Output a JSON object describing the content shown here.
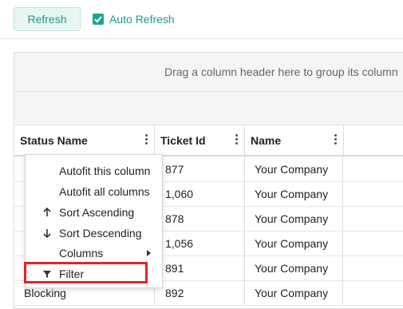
{
  "toolbar": {
    "refresh_label": "Refresh",
    "auto_refresh_label": "Auto Refresh",
    "auto_refresh_checked": true
  },
  "grid": {
    "group_panel_text": "Drag a column header here to group its column",
    "columns": [
      {
        "label": "Status Name"
      },
      {
        "label": "Ticket Id"
      },
      {
        "label": "Name"
      }
    ],
    "rows": [
      {
        "status": "",
        "ticket": "877",
        "name": "Your Company"
      },
      {
        "status": "",
        "ticket": "1,060",
        "name": "Your Company"
      },
      {
        "status": "",
        "ticket": "878",
        "name": "Your Company"
      },
      {
        "status": "",
        "ticket": "1,056",
        "name": "Your Company"
      },
      {
        "status": "",
        "ticket": "891",
        "name": "Your Company"
      },
      {
        "status": "Blocking",
        "ticket": "892",
        "name": "Your Company"
      }
    ]
  },
  "context_menu": {
    "items": [
      {
        "label": "Autofit this column",
        "icon": ""
      },
      {
        "label": "Autofit all columns",
        "icon": ""
      },
      {
        "label": "Sort Ascending",
        "icon": "arrow-up-icon"
      },
      {
        "label": "Sort Descending",
        "icon": "arrow-down-icon"
      },
      {
        "label": "Columns",
        "icon": "",
        "has_submenu": true
      },
      {
        "label": "Filter",
        "icon": "filter-icon",
        "highlighted": true
      }
    ]
  },
  "colors": {
    "accent": "#20a48e",
    "highlight_border": "#e32424"
  }
}
